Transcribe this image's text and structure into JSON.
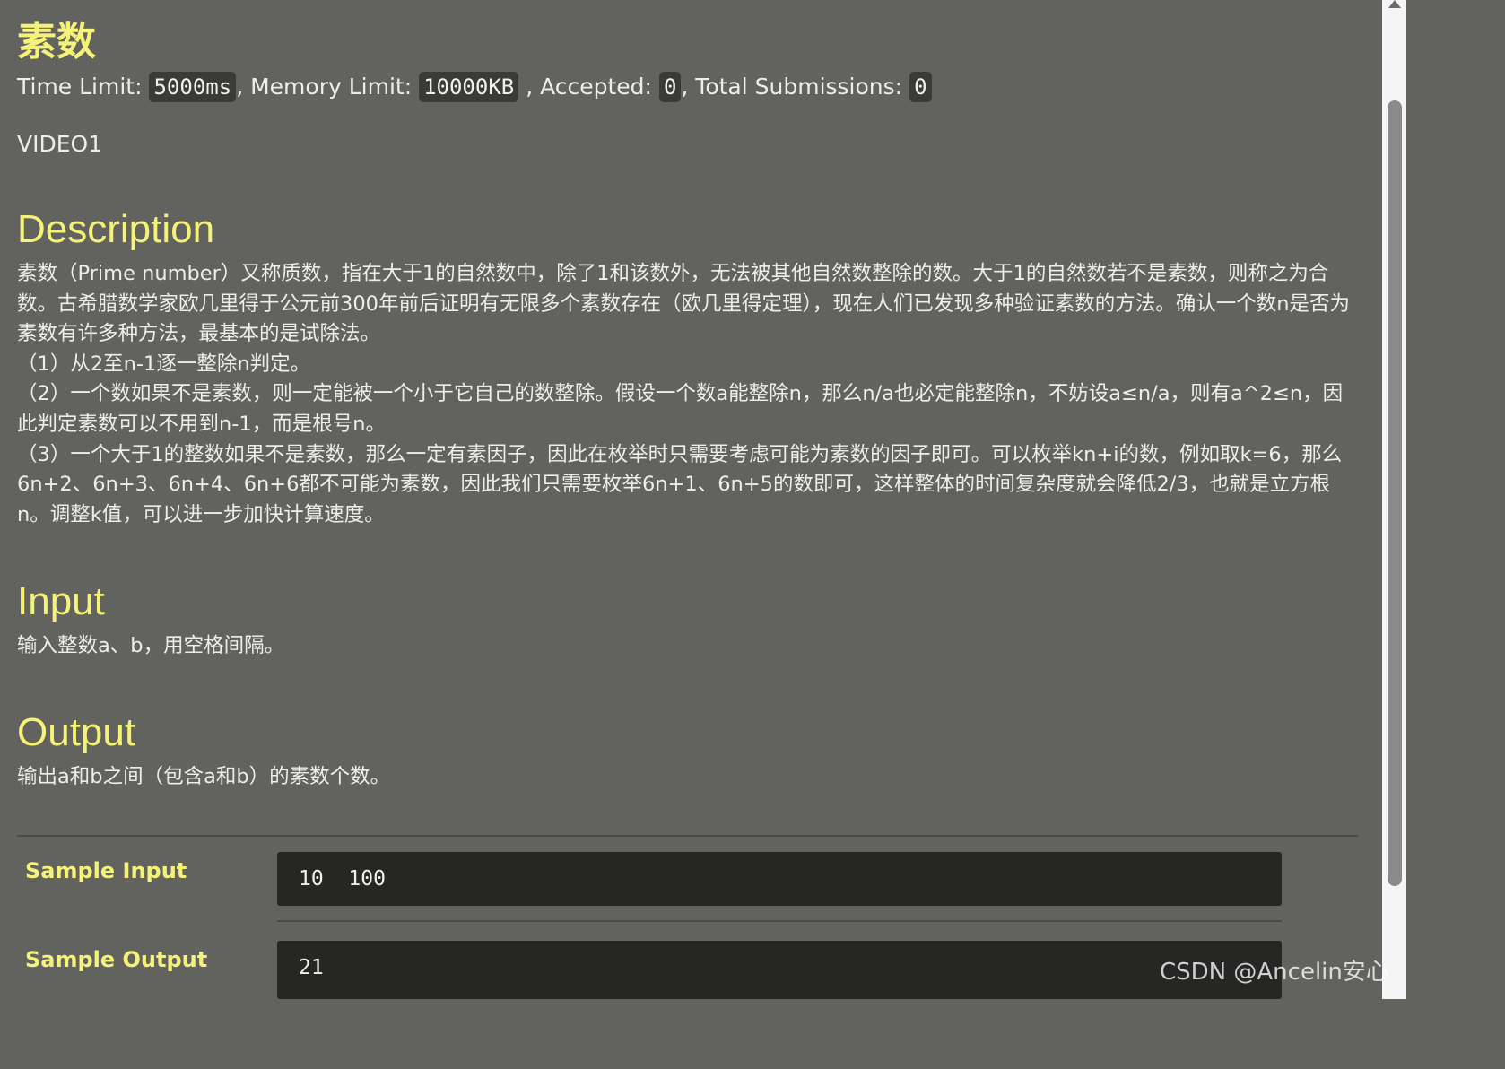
{
  "problem": {
    "title": "素数",
    "limits": {
      "time_label": "Time Limit:",
      "time_value": "5000ms",
      "memory_label": "Memory Limit:",
      "memory_value": "10000KB",
      "accepted_label": "Accepted:",
      "accepted_value": "0",
      "submissions_label": "Total Submissions:",
      "submissions_value": "0"
    },
    "video_label": "VIDEO1"
  },
  "description": {
    "heading": "Description",
    "paragraphs": [
      "素数（Prime number）又称质数，指在大于1的自然数中，除了1和该数外，无法被其他自然数整除的数。大于1的自然数若不是素数，则称之为合数。古希腊数学家欧几里得于公元前300年前后证明有无限多个素数存在（欧几里得定理），现在人们已发现多种验证素数的方法。确认一个数n是否为素数有许多种方法，最基本的是试除法。",
      "（1）从2至n-1逐一整除n判定。",
      "（2）一个数如果不是素数，则一定能被一个小于它自己的数整除。假设一个数a能整除n，那么n/a也必定能整除n，不妨设a≤n/a，则有a^2≤n，因此判定素数可以不用到n-1，而是根号n。",
      "（3）一个大于1的整数如果不是素数，那么一定有素因子，因此在枚举时只需要考虑可能为素数的因子即可。可以枚举kn+i的数，例如取k=6，那么6n+2、6n+3、6n+4、6n+6都不可能为素数，因此我们只需要枚举6n+1、6n+5的数即可，这样整体的时间复杂度就会降低2/3，也就是立方根n。调整k值，可以进一步加快计算速度。"
    ]
  },
  "input": {
    "heading": "Input",
    "text": "输入整数a、b，用空格间隔。"
  },
  "output": {
    "heading": "Output",
    "text": "输出a和b之间（包含a和b）的素数个数。"
  },
  "samples": {
    "input_label": "Sample Input",
    "input_value": "10  100",
    "output_label": "Sample Output",
    "output_value": "21"
  },
  "watermark": "CSDN @Ancelin安心",
  "colors": {
    "background": "#62625f",
    "heading": "#f5f27a",
    "code_bg": "#262625",
    "badge_bg": "#3a3a38"
  }
}
